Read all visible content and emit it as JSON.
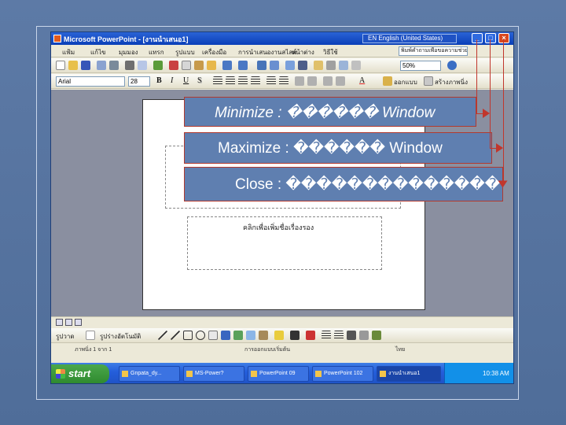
{
  "window": {
    "title": "Microsoft PowerPoint - [งานนำเสนอ1]",
    "language": "EN English (United States)",
    "min_glyph": "_",
    "max_glyph": "□",
    "close_glyph": "×"
  },
  "menu": {
    "items": [
      "แฟ้ม",
      "แก้ไข",
      "มุมมอง",
      "แทรก",
      "รูปแบบ",
      "เครื่องมือ",
      "การนำเสนองานสไลด์",
      "หน้าต่าง",
      "วิธีใช้"
    ],
    "help_placeholder": "พิมพ์คำถามเพื่อขอความช่วยเหลือ"
  },
  "toolbar": {
    "zoom": "50%",
    "font": "Arial",
    "size": "28",
    "bold": "B",
    "italic": "I",
    "underline": "U",
    "shadow": "S",
    "font_color": "A",
    "design_label": "ออกแบบ",
    "new_slide_label": "สร้างภาพนิ่ง"
  },
  "slide": {
    "subtitle_placeholder": "คลิกเพื่อเพิ่มชื่อเรื่องรอง"
  },
  "drawbar": {
    "draw_label": "รูปวาด",
    "autoshapes_label": "รูปร่างอัตโนมัติ"
  },
  "status": {
    "slide": "ภาพนิ่ง 1 จาก 1",
    "design": "การออกแบบเริ่มต้น",
    "language": "ไทย"
  },
  "taskbar": {
    "start": "start",
    "tasks": [
      "Gnpata_dy...",
      "MS-Power?",
      "PowerPoint 09",
      "PowerPoint 102",
      "งานนำเสนอ1"
    ],
    "clock": "10:38 AM"
  },
  "callouts": {
    "minimize": "Minimize : ������ Window",
    "maximize": "Maximize : ������ Window",
    "close": "Close : ��������������"
  },
  "colors": {
    "background": "#5d7aa6",
    "callout_fill": "#5f7fb0",
    "arrow": "#c1362c",
    "xp_blue": "#0a3fb8"
  }
}
